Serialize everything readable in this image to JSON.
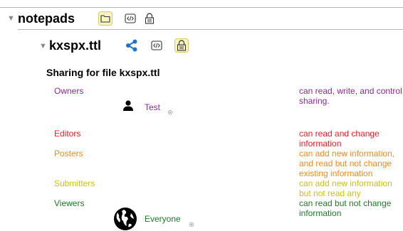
{
  "notepads": {
    "title": "notepads",
    "icons": [
      "folder-icon",
      "code-icon",
      "lock-icon"
    ]
  },
  "file": {
    "title": "kxspx.ttl",
    "icons": [
      "share-icon",
      "code-icon",
      "lock-icon"
    ]
  },
  "sharing": {
    "heading": "Sharing for file kxspx.ttl",
    "groups": [
      {
        "role": "Owners",
        "color": "#8c2a94",
        "description": "can read, write, and control sharing.",
        "member": "Test"
      },
      {
        "role": "Editors",
        "color": "#ee1b24",
        "description": "can read and change information"
      },
      {
        "role": "Posters",
        "color": "#f08a22",
        "description": "can add new information, and read but not change existing information"
      },
      {
        "role": "Submitters",
        "color": "#c9c30d",
        "description": "can add new information but not read any"
      },
      {
        "role": "Viewers",
        "color": "#1d7a26",
        "description": "can read but not change information",
        "member": "Everyone"
      }
    ]
  }
}
